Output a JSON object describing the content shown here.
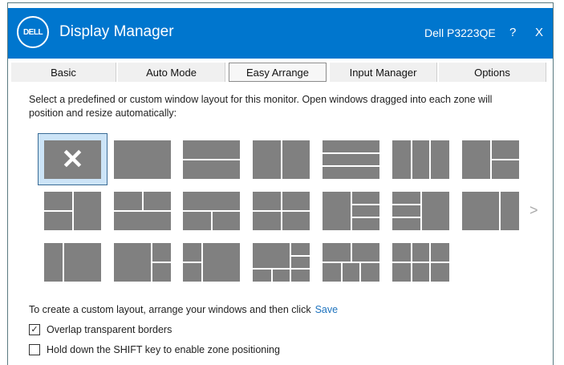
{
  "titlebar": {
    "logo": "DELL",
    "title": "Display Manager",
    "model": "Dell P3223QE",
    "help": "?",
    "close": "X"
  },
  "tabs": [
    {
      "label": "Basic"
    },
    {
      "label": "Auto Mode"
    },
    {
      "label": "Easy Arrange",
      "active": true
    },
    {
      "label": "Input Manager"
    },
    {
      "label": "Options"
    }
  ],
  "description": "Select a predefined or custom window layout for this monitor.  Open windows dragged into each zone will position and resize automatically:",
  "layouts": {
    "selected_index": 0,
    "count": 20,
    "none_icon": "✕",
    "next_icon": ">"
  },
  "custom": {
    "text": "To create a custom layout, arrange your windows and then click",
    "save_label": "Save"
  },
  "options": [
    {
      "label": "Overlap transparent borders",
      "checked": true,
      "mark": "✓"
    },
    {
      "label": "Hold down the SHIFT key to enable zone positioning",
      "checked": false
    }
  ],
  "colors": {
    "titlebar": "#0076ce",
    "zone": "#808080",
    "link": "#1e73be"
  }
}
